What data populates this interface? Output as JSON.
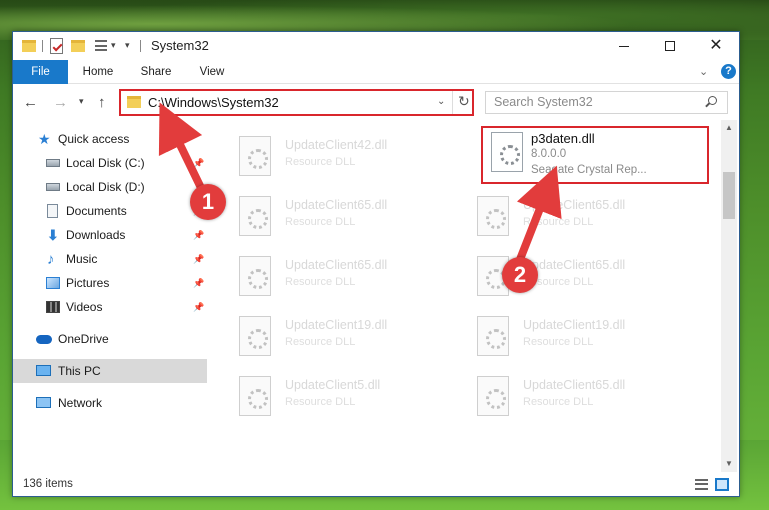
{
  "window": {
    "title": "System32",
    "controls": {
      "minimize": "minimize",
      "maximize": "maximize",
      "close": "close"
    }
  },
  "ribbon": {
    "tabs": [
      {
        "label": "File"
      },
      {
        "label": "Home"
      },
      {
        "label": "Share"
      },
      {
        "label": "View"
      }
    ],
    "help": "?"
  },
  "address_bar": {
    "path": "C:\\Windows\\System32",
    "highlight_color": "#d9262c"
  },
  "search": {
    "placeholder": "Search System32"
  },
  "navigation": {
    "items": [
      {
        "label": "Quick access",
        "icon": "star-icon"
      },
      {
        "label": "Local Disk (C:)",
        "icon": "disk-icon",
        "pinned": true
      },
      {
        "label": "Local Disk (D:)",
        "icon": "disk-icon"
      },
      {
        "label": "Documents",
        "icon": "documents-icon",
        "pinned": true
      },
      {
        "label": "Downloads",
        "icon": "downloads-icon",
        "pinned": true
      },
      {
        "label": "Music",
        "icon": "music-icon",
        "pinned": true
      },
      {
        "label": "Pictures",
        "icon": "pictures-icon",
        "pinned": true
      },
      {
        "label": "Videos",
        "icon": "videos-icon",
        "pinned": true
      },
      {
        "label": "OneDrive",
        "icon": "onedrive-icon"
      },
      {
        "label": "This PC",
        "icon": "this-pc-icon",
        "selected": true
      },
      {
        "label": "Network",
        "icon": "network-icon"
      }
    ]
  },
  "files": {
    "left_column": [
      {
        "name": "UpdateClient42.dll",
        "type": "Resource DLL"
      },
      {
        "name": "UpdateClient65.dll",
        "type": "Resource DLL"
      },
      {
        "name": "UpdateClient65.dll",
        "type": "Resource DLL"
      },
      {
        "name": "UpdateClient19.dll",
        "type": "Resource DLL"
      },
      {
        "name": "UpdateClient5.dll",
        "type": "Resource DLL"
      }
    ],
    "right_column": [
      {
        "name": "p3daten.dll",
        "version": "8.0.0.0",
        "type": "Seagate Crystal Rep...",
        "highlighted": true
      },
      {
        "name": "UpdateClient65.dll",
        "type": "Resource DLL"
      },
      {
        "name": "UpdateClient65.dll",
        "type": "Resource DLL"
      },
      {
        "name": "UpdateClient19.dll",
        "type": "Resource DLL"
      },
      {
        "name": "UpdateClient65.dll",
        "type": "Resource DLL"
      }
    ]
  },
  "status": {
    "item_count": "136 items"
  },
  "annotations": {
    "step1": "1",
    "step2": "2",
    "color": "#e23c3c"
  }
}
